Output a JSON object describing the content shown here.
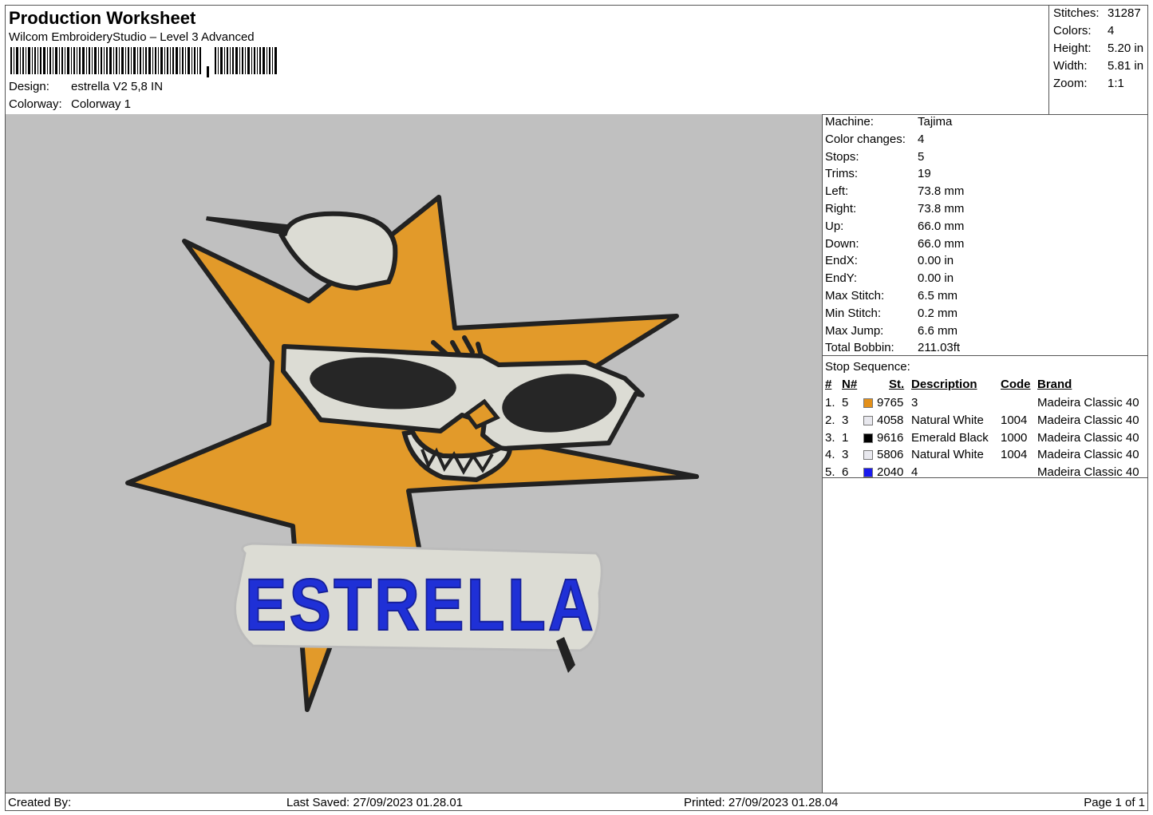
{
  "header": {
    "title": "Production Worksheet",
    "software": "Wilcom EmbroideryStudio – Level 3 Advanced",
    "design_label": "Design:",
    "design_value": "estrella V2 5,8 IN",
    "colorway_label": "Colorway:",
    "colorway_value": "Colorway 1"
  },
  "stats": [
    {
      "label": "Stitches:",
      "value": "31287"
    },
    {
      "label": "Colors:",
      "value": "4"
    },
    {
      "label": "Height:",
      "value": "5.20 in"
    },
    {
      "label": "Width:",
      "value": "5.81 in"
    },
    {
      "label": "Zoom:",
      "value": "1:1"
    }
  ],
  "design_text": "ESTRELLA",
  "props": [
    {
      "label": "Machine:",
      "value": "Tajima"
    },
    {
      "label": "Color changes:",
      "value": "4"
    },
    {
      "label": "Stops:",
      "value": "5"
    },
    {
      "label": "Trims:",
      "value": "19"
    },
    {
      "label": "Left:",
      "value": "73.8 mm"
    },
    {
      "label": "Right:",
      "value": "73.8 mm"
    },
    {
      "label": "Up:",
      "value": "66.0 mm"
    },
    {
      "label": "Down:",
      "value": "66.0 mm"
    },
    {
      "label": "EndX:",
      "value": "0.00 in"
    },
    {
      "label": "EndY:",
      "value": "0.00 in"
    },
    {
      "label": "Max Stitch:",
      "value": "6.5 mm"
    },
    {
      "label": "Min Stitch:",
      "value": "0.2 mm"
    },
    {
      "label": "Max Jump:",
      "value": "6.6 mm"
    },
    {
      "label": "Total Bobbin:",
      "value": "211.03ft"
    }
  ],
  "stop_sequence": {
    "caption": "Stop Sequence:",
    "headers": {
      "num": "#",
      "needle": "N#",
      "st": "St.",
      "description": "Description",
      "code": "Code",
      "brand": "Brand"
    },
    "rows": [
      {
        "num": "1.",
        "needle": "5",
        "color": "#e3901a",
        "st": "9765",
        "description": "3",
        "code": "",
        "brand": "Madeira Classic 40"
      },
      {
        "num": "2.",
        "needle": "3",
        "color": "#e8e8ee",
        "st": "4058",
        "description": "Natural White",
        "code": "1004",
        "brand": "Madeira Classic 40"
      },
      {
        "num": "3.",
        "needle": "1",
        "color": "#000000",
        "st": "9616",
        "description": "Emerald Black",
        "code": "1000",
        "brand": "Madeira Classic 40"
      },
      {
        "num": "4.",
        "needle": "3",
        "color": "#e8e8ee",
        "st": "5806",
        "description": "Natural White",
        "code": "1004",
        "brand": "Madeira Classic 40"
      },
      {
        "num": "5.",
        "needle": "6",
        "color": "#1a1aee",
        "st": "2040",
        "description": "4",
        "code": "",
        "brand": "Madeira Classic 40"
      }
    ]
  },
  "footer": {
    "created": "Created By:",
    "saved": "Last Saved: 27/09/2023 01.28.01",
    "printed": "Printed: 27/09/2023 01.28.04",
    "page": "Page 1 of 1"
  }
}
